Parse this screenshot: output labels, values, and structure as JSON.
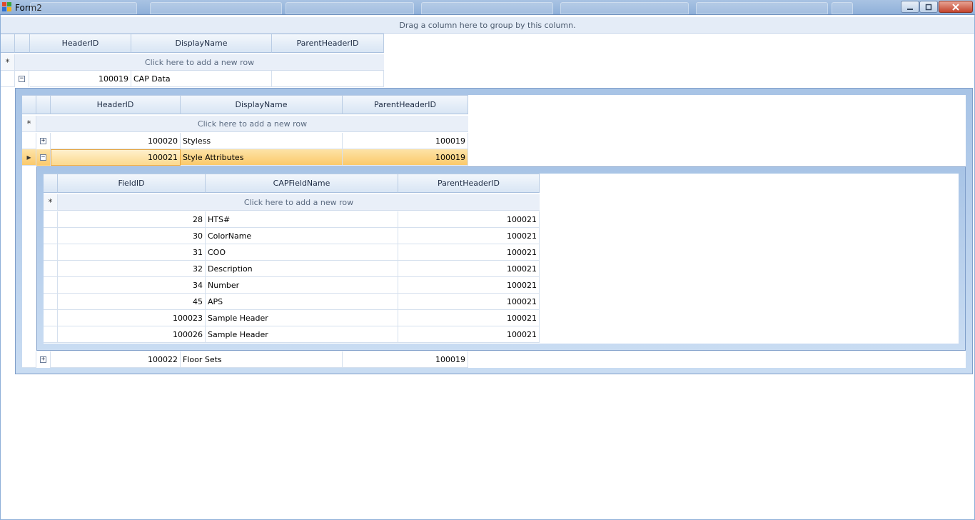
{
  "window": {
    "title": "Form2",
    "group_panel_text": "Drag a column here to group by this column."
  },
  "level1": {
    "columns": [
      "HeaderID",
      "DisplayName",
      "ParentHeaderID"
    ],
    "new_row_text": "Click here to add a new row",
    "rows": [
      {
        "HeaderID": "100019",
        "DisplayName": "CAP Data",
        "ParentHeaderID": "",
        "expanded": true
      }
    ]
  },
  "level2": {
    "columns": [
      "HeaderID",
      "DisplayName",
      "ParentHeaderID"
    ],
    "new_row_text": "Click here to add a new row",
    "rows": [
      {
        "HeaderID": "100020",
        "DisplayName": "Styless",
        "ParentHeaderID": "100019",
        "expanded": false
      },
      {
        "HeaderID": "100021",
        "DisplayName": "Style Attributes",
        "ParentHeaderID": "100019",
        "expanded": true,
        "selected": true
      },
      {
        "HeaderID": "100022",
        "DisplayName": "Floor Sets",
        "ParentHeaderID": "100019",
        "expanded": false
      }
    ]
  },
  "level3": {
    "columns": [
      "FieldID",
      "CAPFieldName",
      "ParentHeaderID"
    ],
    "new_row_text": "Click here to add a new row",
    "rows": [
      {
        "FieldID": "28",
        "CAPFieldName": "HTS#",
        "ParentHeaderID": "100021"
      },
      {
        "FieldID": "30",
        "CAPFieldName": "ColorName",
        "ParentHeaderID": "100021"
      },
      {
        "FieldID": "31",
        "CAPFieldName": "COO",
        "ParentHeaderID": "100021"
      },
      {
        "FieldID": "32",
        "CAPFieldName": "Description",
        "ParentHeaderID": "100021"
      },
      {
        "FieldID": "34",
        "CAPFieldName": "Number",
        "ParentHeaderID": "100021"
      },
      {
        "FieldID": "45",
        "CAPFieldName": "APS",
        "ParentHeaderID": "100021"
      },
      {
        "FieldID": "100023",
        "CAPFieldName": "Sample Header",
        "ParentHeaderID": "100021"
      },
      {
        "FieldID": "100026",
        "CAPFieldName": "Sample Header",
        "ParentHeaderID": "100021"
      }
    ]
  },
  "glyphs": {
    "new_row_marker": "*",
    "current_row_marker": "▸",
    "expand": "+",
    "collapse": "−"
  },
  "icons": [
    "form-icon",
    "minimize-icon",
    "maximize-icon",
    "close-icon",
    "expand-icon",
    "collapse-icon",
    "current-row-icon",
    "new-row-icon"
  ],
  "colors": {
    "selection": "#fbc96a",
    "header": "#d8e5f4",
    "detail_frame": "#a8c4e6"
  }
}
